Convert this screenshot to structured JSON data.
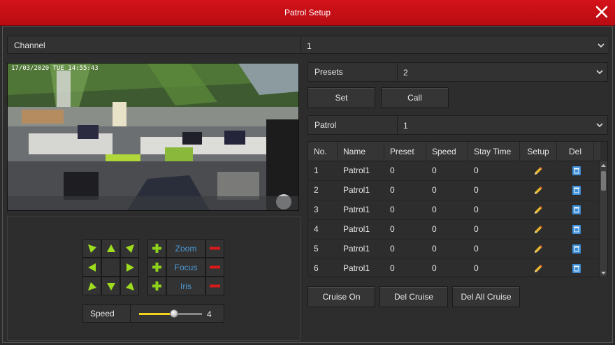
{
  "title": "Patrol Setup",
  "channel": {
    "label": "Channel",
    "value": "1"
  },
  "preview": {
    "overlay_text": "17/03/2020 TUE 14:55:43"
  },
  "presets": {
    "label": "Presets",
    "value": "2",
    "set_label": "Set",
    "call_label": "Call"
  },
  "patrol": {
    "label": "Patrol",
    "value": "1"
  },
  "table": {
    "headers": [
      "No.",
      "Name",
      "Preset",
      "Speed",
      "Stay Time",
      "Setup",
      "Del"
    ],
    "rows": [
      {
        "no": "1",
        "name": "Patrol1",
        "preset": "0",
        "speed": "0",
        "stay": "0"
      },
      {
        "no": "2",
        "name": "Patrol1",
        "preset": "0",
        "speed": "0",
        "stay": "0"
      },
      {
        "no": "3",
        "name": "Patrol1",
        "preset": "0",
        "speed": "0",
        "stay": "0"
      },
      {
        "no": "4",
        "name": "Patrol1",
        "preset": "0",
        "speed": "0",
        "stay": "0"
      },
      {
        "no": "5",
        "name": "Patrol1",
        "preset": "0",
        "speed": "0",
        "stay": "0"
      },
      {
        "no": "6",
        "name": "Patrol1",
        "preset": "0",
        "speed": "0",
        "stay": "0"
      }
    ]
  },
  "ptz": {
    "zoom": "Zoom",
    "focus": "Focus",
    "iris": "Iris",
    "speed_label": "Speed",
    "speed_value": "4",
    "speed_fraction": 0.55
  },
  "buttons": {
    "cruise_on": "Cruise On",
    "del_cruise": "Del Cruise",
    "del_all_cruise": "Del All Cruise"
  },
  "icons": {
    "close": "close-icon",
    "chevron": "chevron-down-icon",
    "pencil": "pencil-icon",
    "delete": "trash-icon",
    "arrow": "triangle-arrow-icon",
    "plus": "plus-icon",
    "minus": "minus-icon"
  },
  "colors": {
    "titlebar": "#c8101a",
    "arrow": "#9edc1e",
    "plus": "#8fd21c",
    "minus": "#d81a1a",
    "link": "#4a9ad8",
    "pencil": "#e8b830",
    "trash": "#3c8ed8"
  }
}
